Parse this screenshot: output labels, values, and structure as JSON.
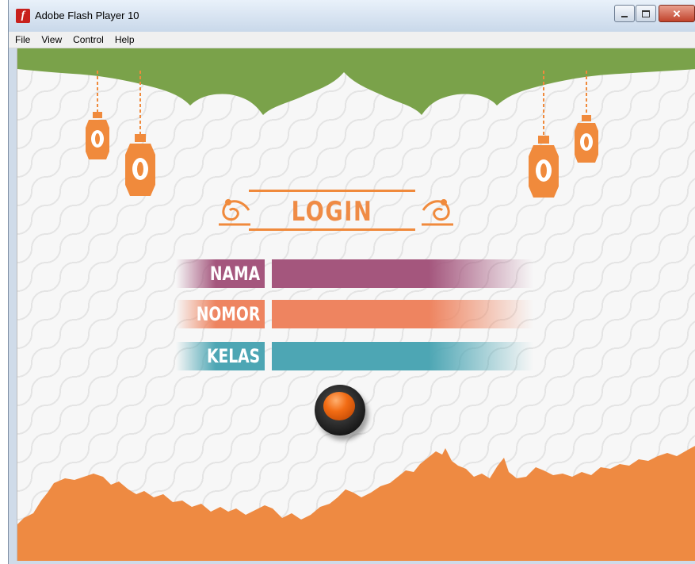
{
  "window": {
    "title": "Adobe Flash Player 10",
    "icon": "flash-player-icon",
    "app_icon_glyph": "f",
    "close_glyph": "✕"
  },
  "menu": [
    "File",
    "View",
    "Control",
    "Help"
  ],
  "login": {
    "heading": "LOGIN",
    "fields": [
      {
        "label": "NAMA",
        "value": "",
        "color": "#a4567d"
      },
      {
        "label": "NOMOR",
        "value": "",
        "color": "#ee8460"
      },
      {
        "label": "KELAS",
        "value": "",
        "color": "#4da6b4"
      }
    ],
    "submit_icon": "orange-round-button-icon"
  },
  "colors": {
    "top_banner": "#7aa24a",
    "lantern": "#f08a3c",
    "bottom_terrain": "#ee8a42",
    "background": "#f7f7f7"
  }
}
